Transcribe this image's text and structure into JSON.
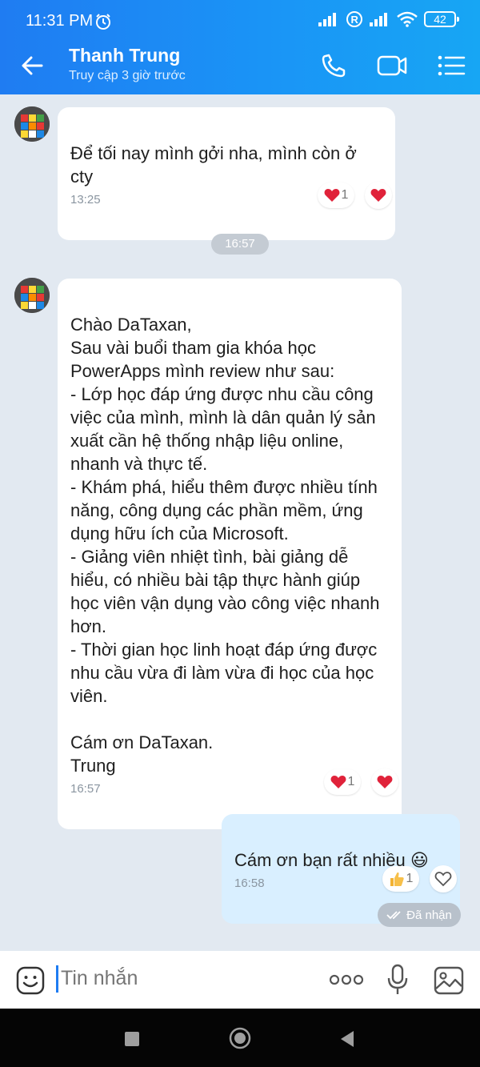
{
  "status_bar": {
    "time": "11:31 PM",
    "battery": "42"
  },
  "header": {
    "name": "Thanh Trung",
    "status": "Truy cập 3 giờ trước"
  },
  "messages": [
    {
      "text": "Để tối nay mình gởi nha, mình còn ở cty",
      "time": "13:25",
      "reaction_count": "1"
    },
    {
      "text": "Chào DaTaxan,\nSau vài buổi tham gia khóa học PowerApps mình review như sau:\n- Lớp học đáp ứng được nhu cầu công việc của mình, mình là dân quản lý sản xuất cần hệ thống nhập liệu online, nhanh và thực tế.\n- Khám phá, hiểu thêm được nhiều tính năng, công dụng các phần mềm, ứng dụng hữu ích của Microsoft.\n- Giảng viên nhiệt tình, bài giảng dễ hiểu, có nhiều bài tập thực hành giúp học viên vận dụng vào công việc nhanh hơn.\n- Thời gian học linh hoạt đáp ứng được nhu cầu vừa đi làm vừa đi học của học viên.\n\nCám ơn DaTaxan.\nTrung",
      "time": "16:57",
      "reaction_count": "1"
    },
    {
      "text": "Cám ơn bạn rất nhiều 😃",
      "time": "16:58",
      "reaction_count": "1"
    }
  ],
  "time_separator": "16:57",
  "delivery_status": "Đã nhận",
  "input": {
    "placeholder": "Tin nhắn"
  }
}
